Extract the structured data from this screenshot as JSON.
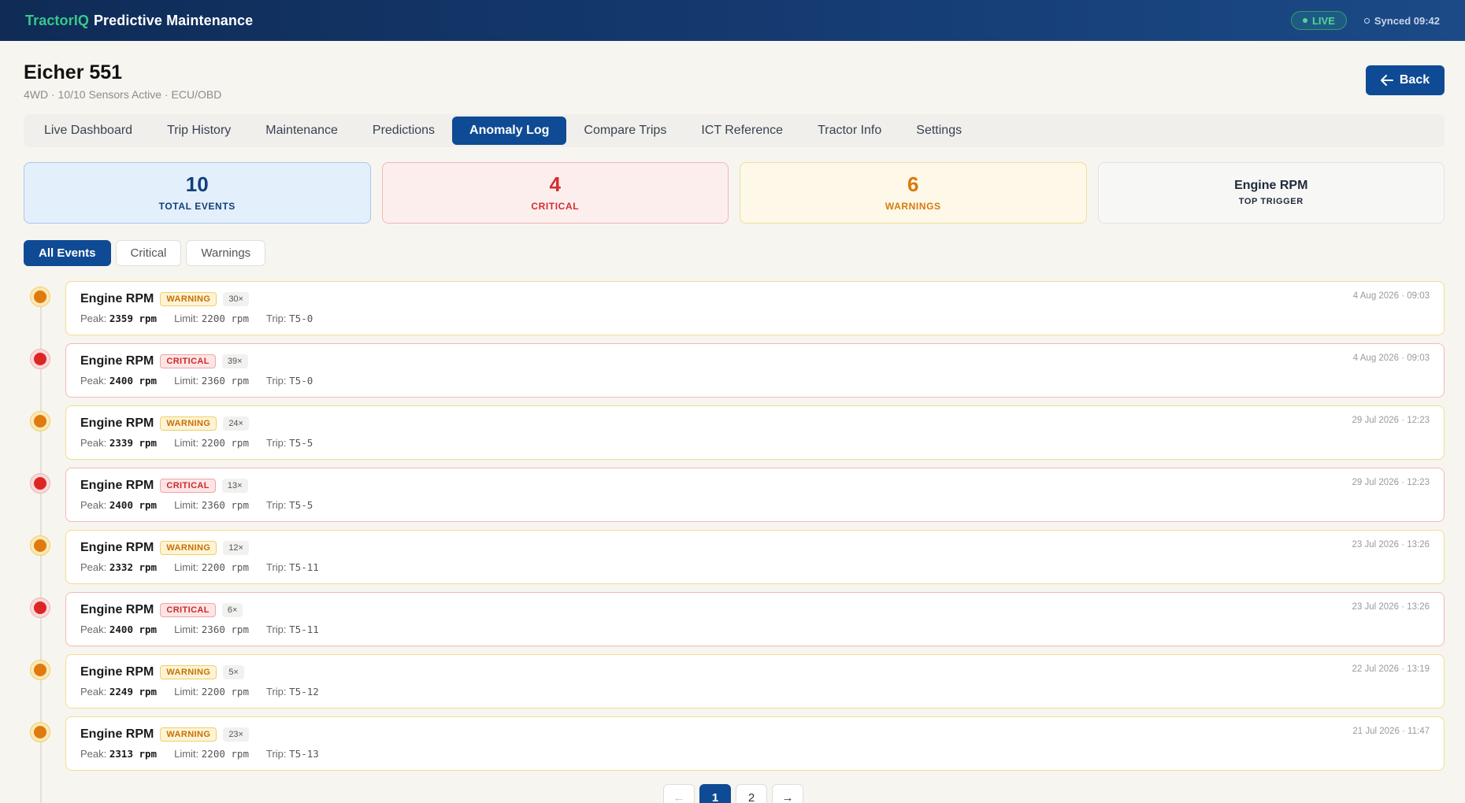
{
  "header": {
    "brand_accent": "TractorIQ",
    "brand_rest": "Predictive Maintenance",
    "live_label": "LIVE",
    "synced_label": "Synced 09:42"
  },
  "vehicle": {
    "title": "Eicher 551",
    "subtitle": "4WD · 10/10 Sensors Active · ECU/OBD"
  },
  "back_label": "Back",
  "tabs": [
    {
      "label": "Live Dashboard"
    },
    {
      "label": "Trip History"
    },
    {
      "label": "Maintenance"
    },
    {
      "label": "Predictions"
    },
    {
      "label": "Anomaly Log",
      "active": true
    },
    {
      "label": "Compare Trips"
    },
    {
      "label": "ICT Reference"
    },
    {
      "label": "Tractor Info"
    },
    {
      "label": "Settings"
    }
  ],
  "stats": {
    "total": {
      "value": "10",
      "label": "TOTAL EVENTS"
    },
    "critical": {
      "value": "4",
      "label": "CRITICAL"
    },
    "warnings": {
      "value": "6",
      "label": "WARNINGS"
    },
    "trigger": {
      "value": "Engine RPM",
      "label": "TOP TRIGGER"
    }
  },
  "filters": [
    {
      "label": "All Events",
      "active": true
    },
    {
      "label": "Critical"
    },
    {
      "label": "Warnings"
    }
  ],
  "events": [
    {
      "name": "Engine RPM",
      "severity": "warning",
      "badge": "WARNING",
      "count": "30×",
      "peak_label": "Peak:",
      "peak": "2359 rpm",
      "limit_label": "Limit:",
      "limit": "2200 rpm",
      "trip_label": "Trip:",
      "trip": "T5-0",
      "timestamp": "4 Aug 2026 · 09:03"
    },
    {
      "name": "Engine RPM",
      "severity": "critical",
      "badge": "CRITICAL",
      "count": "39×",
      "peak_label": "Peak:",
      "peak": "2400 rpm",
      "limit_label": "Limit:",
      "limit": "2360 rpm",
      "trip_label": "Trip:",
      "trip": "T5-0",
      "timestamp": "4 Aug 2026 · 09:03"
    },
    {
      "name": "Engine RPM",
      "severity": "warning",
      "badge": "WARNING",
      "count": "24×",
      "peak_label": "Peak:",
      "peak": "2339 rpm",
      "limit_label": "Limit:",
      "limit": "2200 rpm",
      "trip_label": "Trip:",
      "trip": "T5-5",
      "timestamp": "29 Jul 2026 · 12:23"
    },
    {
      "name": "Engine RPM",
      "severity": "critical",
      "badge": "CRITICAL",
      "count": "13×",
      "peak_label": "Peak:",
      "peak": "2400 rpm",
      "limit_label": "Limit:",
      "limit": "2360 rpm",
      "trip_label": "Trip:",
      "trip": "T5-5",
      "timestamp": "29 Jul 2026 · 12:23"
    },
    {
      "name": "Engine RPM",
      "severity": "warning",
      "badge": "WARNING",
      "count": "12×",
      "peak_label": "Peak:",
      "peak": "2332 rpm",
      "limit_label": "Limit:",
      "limit": "2200 rpm",
      "trip_label": "Trip:",
      "trip": "T5-11",
      "timestamp": "23 Jul 2026 · 13:26"
    },
    {
      "name": "Engine RPM",
      "severity": "critical",
      "badge": "CRITICAL",
      "count": "6×",
      "peak_label": "Peak:",
      "peak": "2400 rpm",
      "limit_label": "Limit:",
      "limit": "2360 rpm",
      "trip_label": "Trip:",
      "trip": "T5-11",
      "timestamp": "23 Jul 2026 · 13:26"
    },
    {
      "name": "Engine RPM",
      "severity": "warning",
      "badge": "WARNING",
      "count": "5×",
      "peak_label": "Peak:",
      "peak": "2249 rpm",
      "limit_label": "Limit:",
      "limit": "2200 rpm",
      "trip_label": "Trip:",
      "trip": "T5-12",
      "timestamp": "22 Jul 2026 · 13:19"
    },
    {
      "name": "Engine RPM",
      "severity": "warning",
      "badge": "WARNING",
      "count": "23×",
      "peak_label": "Peak:",
      "peak": "2313 rpm",
      "limit_label": "Limit:",
      "limit": "2200 rpm",
      "trip_label": "Trip:",
      "trip": "T5-13",
      "timestamp": "21 Jul 2026 · 11:47"
    }
  ],
  "pagination": {
    "prev": "←",
    "pages": [
      "1",
      "2"
    ],
    "current": "1",
    "next": "→"
  },
  "colors": {
    "primary": "#0f4b94",
    "critical": "#dc2626",
    "warning": "#df7a0e",
    "live": "#36c98a"
  }
}
